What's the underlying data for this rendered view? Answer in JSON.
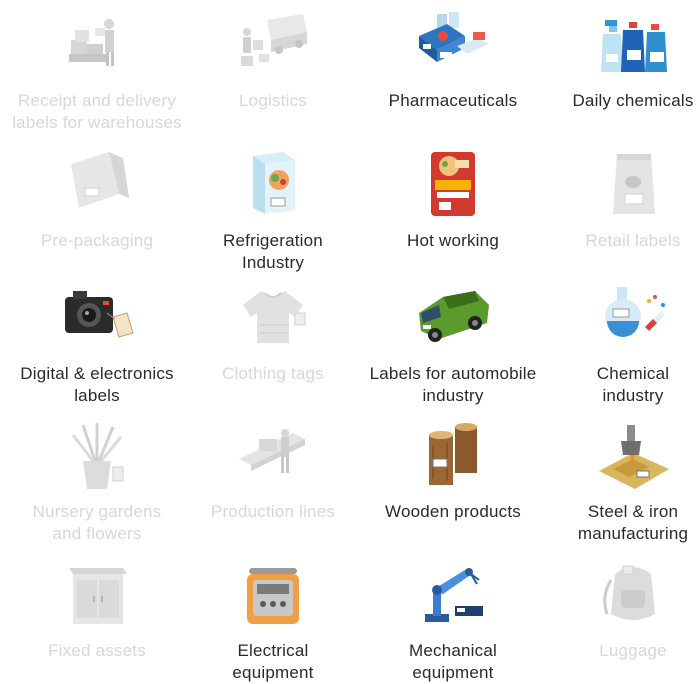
{
  "items": [
    {
      "label": "Receipt and delivery\nlabels for warehouses",
      "icon": "warehouse-workers-icon",
      "active": false
    },
    {
      "label": "Logistics",
      "icon": "delivery-truck-icon",
      "active": false
    },
    {
      "label": "Pharmaceuticals",
      "icon": "medicine-boxes-icon",
      "active": true
    },
    {
      "label": "Daily chemicals",
      "icon": "cleaning-bottles-icon",
      "active": true
    },
    {
      "label": "Pre-packaging",
      "icon": "shopping-bag-icon",
      "active": false
    },
    {
      "label": "Refrigeration\nIndustry",
      "icon": "frozen-food-box-icon",
      "active": true
    },
    {
      "label": "Hot working",
      "icon": "noodle-package-icon",
      "active": true
    },
    {
      "label": "Retail labels",
      "icon": "snack-bag-icon",
      "active": false
    },
    {
      "label": "Digital & electronics\nlabels",
      "icon": "camera-icon",
      "active": true
    },
    {
      "label": "Clothing tags",
      "icon": "sweater-icon",
      "active": false
    },
    {
      "label": "Labels for automobile\nindustry",
      "icon": "green-car-icon",
      "active": true
    },
    {
      "label": "Chemical\nindustry",
      "icon": "lab-flask-icon",
      "active": true
    },
    {
      "label": "Nursery gardens\nand flowers",
      "icon": "potted-plant-icon",
      "active": false
    },
    {
      "label": "Production lines",
      "icon": "conveyor-line-icon",
      "active": false
    },
    {
      "label": "Wooden products",
      "icon": "wood-logs-icon",
      "active": true
    },
    {
      "label": "Steel & iron\nmanufacturing",
      "icon": "steel-ladle-icon",
      "active": true
    },
    {
      "label": "Fixed assets",
      "icon": "cabinet-icon",
      "active": false
    },
    {
      "label": "Electrical\nequipment",
      "icon": "rice-cooker-icon",
      "active": true
    },
    {
      "label": "Mechanical\nequipment",
      "icon": "robot-arm-icon",
      "active": true
    },
    {
      "label": "Luggage",
      "icon": "backpack-icon",
      "active": false
    }
  ]
}
